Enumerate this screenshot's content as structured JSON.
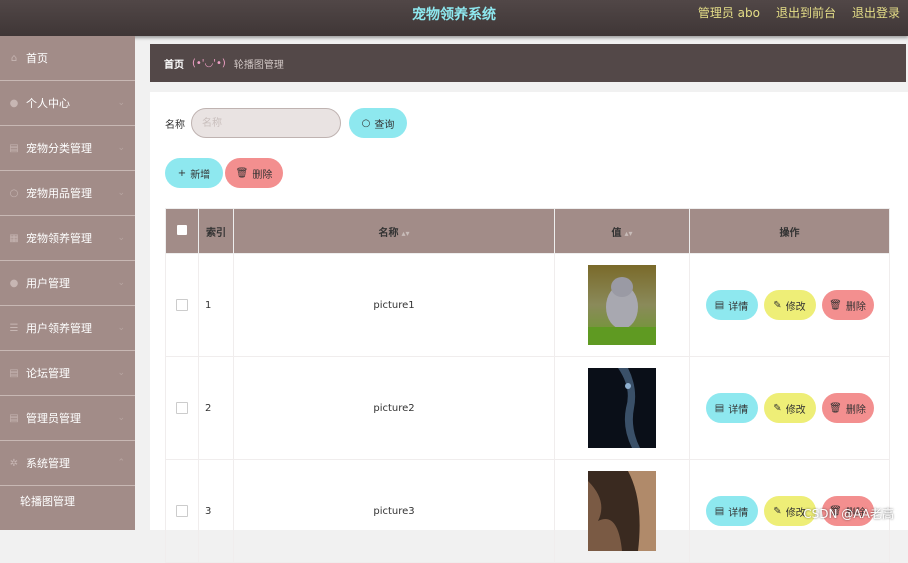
{
  "header": {
    "title": "宠物领养系统",
    "admin": "管理员 abo",
    "front_link": "退出到前台",
    "logout_link": "退出登录"
  },
  "sidebar": {
    "items": [
      {
        "label": "首页",
        "icon": "home-icon"
      },
      {
        "label": "个人中心",
        "icon": "user-icon"
      },
      {
        "label": "宠物分类管理",
        "icon": "document-icon"
      },
      {
        "label": "宠物用品管理",
        "icon": "circle-icon"
      },
      {
        "label": "宠物领养管理",
        "icon": "grid-icon"
      },
      {
        "label": "用户管理",
        "icon": "user-icon"
      },
      {
        "label": "用户领养管理",
        "icon": "list-icon"
      },
      {
        "label": "论坛管理",
        "icon": "document-icon"
      },
      {
        "label": "管理员管理",
        "icon": "document-icon"
      },
      {
        "label": "系统管理",
        "icon": "gear-icon"
      }
    ],
    "sub_item": "轮播图管理"
  },
  "breadcrumb": {
    "home": "首页",
    "face": "(•'◡'•)",
    "current": "轮播图管理"
  },
  "search": {
    "label": "名称",
    "placeholder": "名称",
    "button": "查询"
  },
  "actions": {
    "add": "新增",
    "delete": "删除"
  },
  "table": {
    "headers": [
      "索引",
      "名称",
      "值",
      "操作"
    ],
    "rows": [
      {
        "index": "1",
        "name": "picture1"
      },
      {
        "index": "2",
        "name": "picture2"
      },
      {
        "index": "3",
        "name": "picture3"
      }
    ],
    "row_actions": {
      "detail": "详情",
      "edit": "修改",
      "delete": "删除"
    }
  },
  "watermark": "CSDN @AA老高",
  "colors": {
    "header_bg": "#4a4040",
    "sidebar_bg": "#a28c88",
    "accent_cyan": "#8ee8ef",
    "accent_pink": "#f38f8f",
    "accent_yellow": "#eeee77"
  }
}
